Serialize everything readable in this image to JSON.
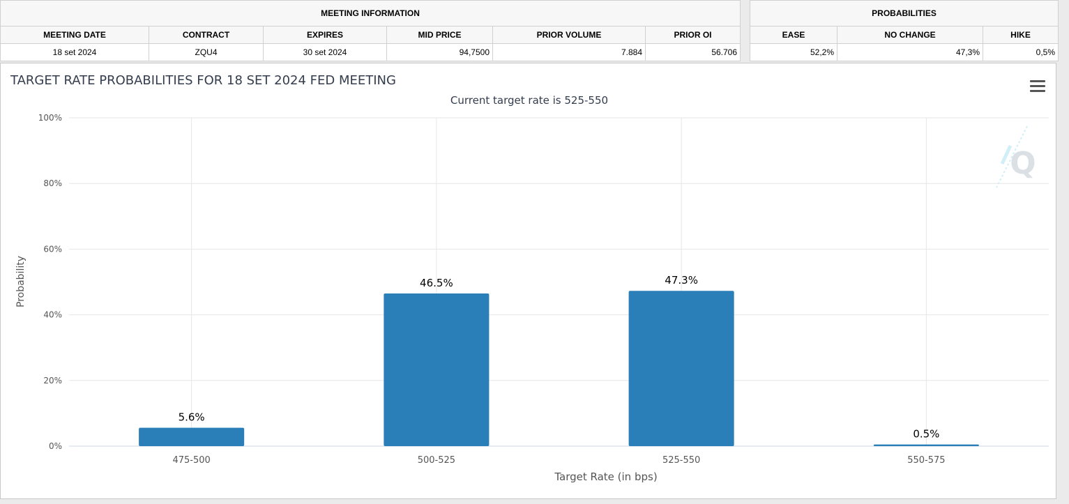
{
  "meeting_info": {
    "group_title": "MEETING INFORMATION",
    "headers": [
      "MEETING DATE",
      "CONTRACT",
      "EXPIRES",
      "MID PRICE",
      "PRIOR VOLUME",
      "PRIOR OI"
    ],
    "row": [
      "18 set 2024",
      "ZQU4",
      "30 set 2024",
      "94,7500",
      "7.884",
      "56.706"
    ]
  },
  "probabilities": {
    "group_title": "PROBABILITIES",
    "headers": [
      "EASE",
      "NO CHANGE",
      "HIKE"
    ],
    "row": [
      "52,2%",
      "47,3%",
      "0,5%"
    ]
  },
  "colors": {
    "bar": "#2a7fb8",
    "grid": "#e6e6e6",
    "title": "#333d4d"
  },
  "icons": {
    "menu": "hamburger-menu-icon",
    "watermark": "q-logo-icon"
  },
  "chart_data": {
    "type": "bar",
    "title": "TARGET RATE PROBABILITIES FOR 18 SET 2024 FED MEETING",
    "subtitle": "Current target rate is 525-550",
    "xlabel": "Target Rate (in bps)",
    "ylabel": "Probability",
    "categories": [
      "475-500",
      "500-525",
      "525-550",
      "550-575"
    ],
    "values": [
      5.6,
      46.5,
      47.3,
      0.5
    ],
    "data_labels": [
      "5.6%",
      "46.5%",
      "47.3%",
      "0.5%"
    ],
    "ylim": [
      0,
      100
    ],
    "yticks": [
      0,
      20,
      40,
      60,
      80,
      100
    ],
    "ytick_labels": [
      "0%",
      "20%",
      "40%",
      "60%",
      "80%",
      "100%"
    ],
    "grid": true,
    "legend": "none"
  }
}
